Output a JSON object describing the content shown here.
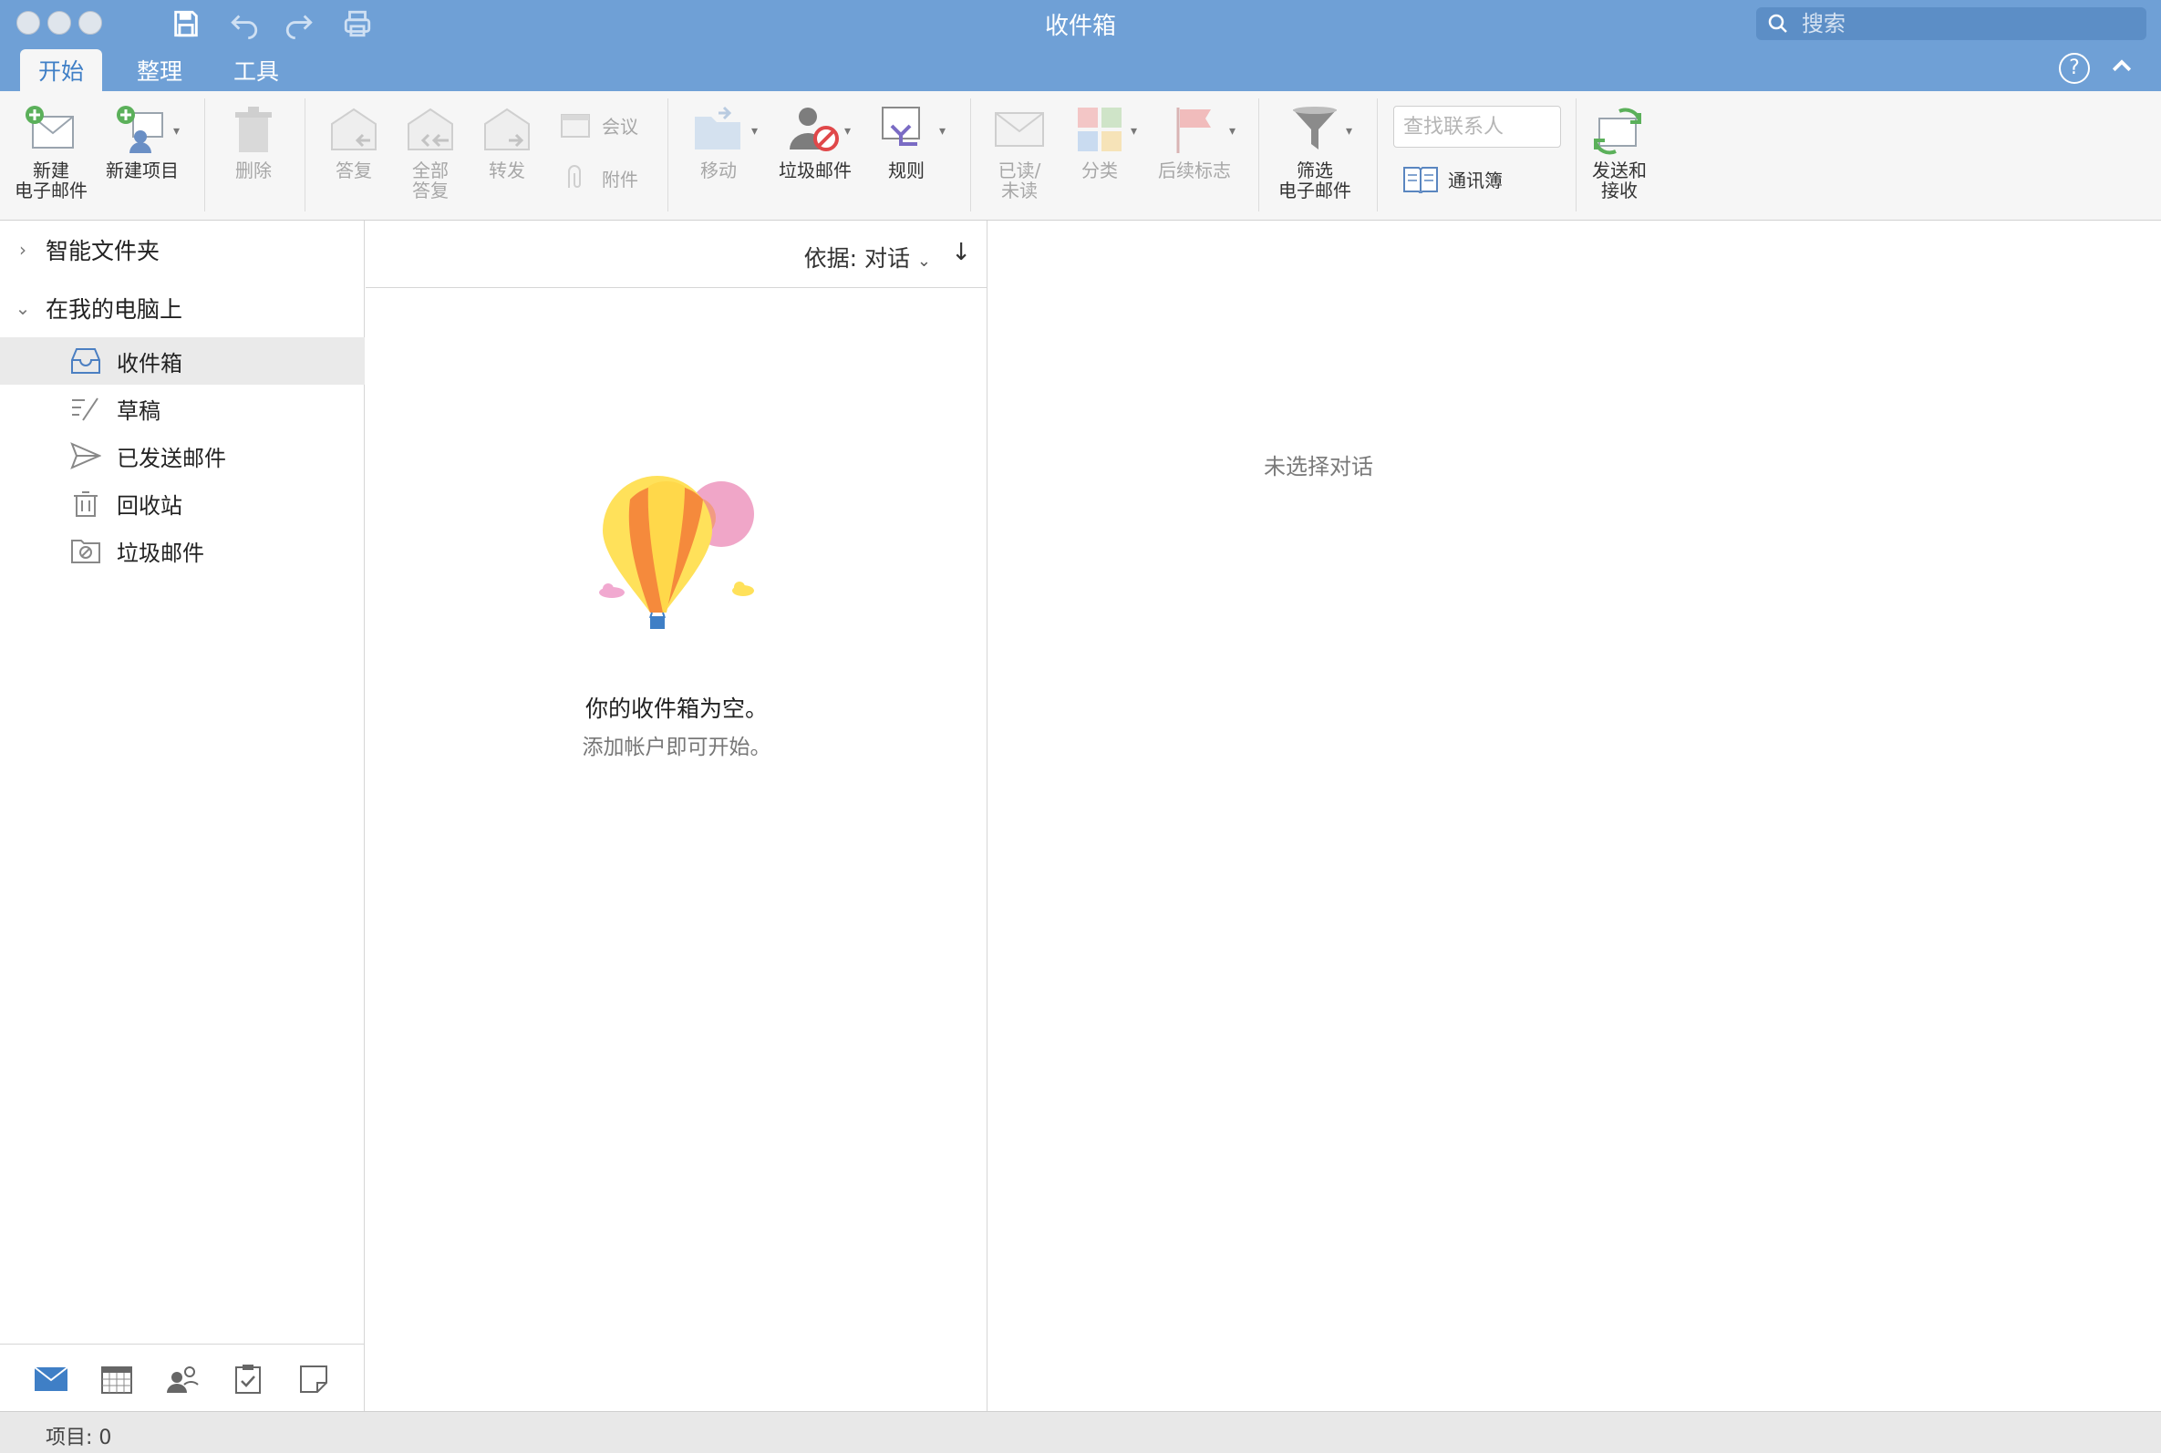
{
  "window": {
    "title": "收件箱",
    "search_placeholder": "搜索"
  },
  "tabs": [
    {
      "label": "开始",
      "active": true
    },
    {
      "label": "整理",
      "active": false
    },
    {
      "label": "工具",
      "active": false
    }
  ],
  "ribbon": {
    "new_email": "新建\n电子邮件",
    "new_item": "新建项目",
    "delete": "删除",
    "reply": "答复",
    "reply_all": "全部\n答复",
    "forward": "转发",
    "meeting": "会议",
    "attachment": "附件",
    "move": "移动",
    "junk": "垃圾邮件",
    "rules": "规则",
    "read_unread": "已读/\n未读",
    "categorize": "分类",
    "follow_up": "后续标志",
    "filter_email": "筛选\n电子邮件",
    "find_contact_placeholder": "查找联系人",
    "address_book": "通讯簿",
    "send_receive": "发送和\n接收"
  },
  "folders": {
    "smart_folders": "智能文件夹",
    "on_my_computer": "在我的电脑上",
    "items": [
      {
        "label": "收件箱",
        "icon": "inbox-icon",
        "selected": true
      },
      {
        "label": "草稿",
        "icon": "draft-icon",
        "selected": false
      },
      {
        "label": "已发送邮件",
        "icon": "sent-icon",
        "selected": false
      },
      {
        "label": "回收站",
        "icon": "trash-icon",
        "selected": false
      },
      {
        "label": "垃圾邮件",
        "icon": "junk-folder-icon",
        "selected": false
      }
    ]
  },
  "message_list": {
    "sort_label": "依据: 对话",
    "sort_direction": "↓",
    "empty_title": "你的收件箱为空。",
    "empty_subtitle": "添加帐户即可开始。"
  },
  "reading_pane": {
    "empty_text": "未选择对话"
  },
  "status": {
    "items": "项目: 0"
  },
  "colors": {
    "titlebar": "#6fa0d6",
    "accent": "#3f7fc6",
    "ribbon_bg": "#f6f6f6"
  }
}
